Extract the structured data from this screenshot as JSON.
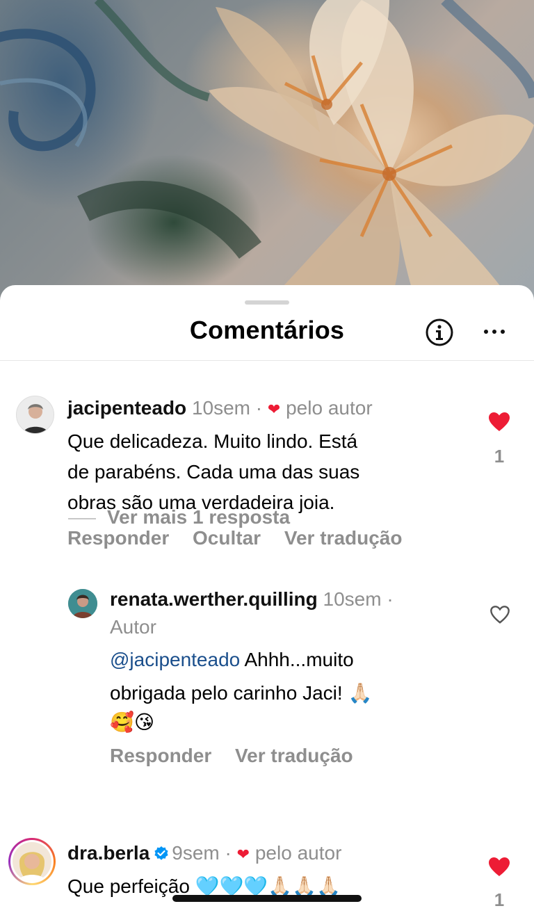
{
  "header": {
    "title": "Comentários"
  },
  "comments": [
    {
      "username": "jacipenteado",
      "time": "10sem",
      "separator": "·",
      "author_like": "pelo autor",
      "lines": [
        "Que delicadeza.  Muito lindo. Está",
        "de parabéns.  Cada uma das suas",
        "obras são uma verdadeira joia."
      ],
      "actions": [
        "Responder",
        "Ocultar",
        "Ver tradução"
      ],
      "likes": "1",
      "liked": true
    },
    {
      "username": "renata.werther.quilling",
      "time": "10sem",
      "separator": "·",
      "badge": "Autor",
      "mention": "@jacipenteado",
      "lines": [
        "Ahhh...muito",
        "obrigada pelo carinho Jaci! 🙏🏻",
        "🥰😘"
      ],
      "actions": [
        "Responder",
        "Ver tradução"
      ],
      "liked": false
    },
    {
      "username": "dra.berla",
      "time": "9sem",
      "separator": "·",
      "author_like": "pelo autor",
      "lines": [
        "Que perfeição 🩵🩵🩵🙏🏻🙏🏻🙏🏻"
      ],
      "likes": "1",
      "liked": true
    }
  ],
  "more_replies": "Ver mais 1 resposta",
  "colors": {
    "heart": "#ed1c35",
    "muted": "#8e8e8e",
    "mention": "#1b4f8c",
    "verified": "#0095f6"
  },
  "icons": [
    "info-icon",
    "more-icon",
    "heart-icon",
    "heart-outline-icon",
    "verified-badge-icon"
  ]
}
